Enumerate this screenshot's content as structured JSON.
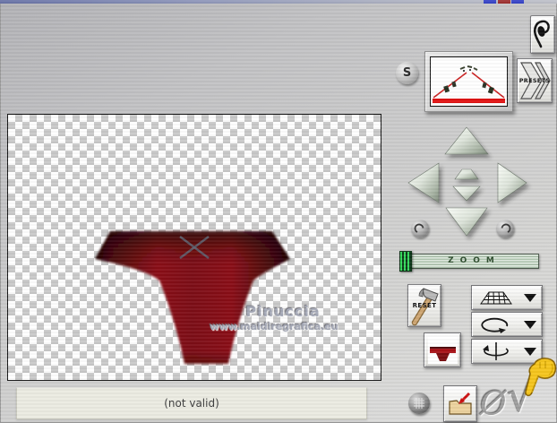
{
  "window": {
    "titlebar_marks": [
      "#3946c8",
      "#a03434",
      "#3946c8"
    ]
  },
  "preview": {
    "watermark_line1": "Pinuccia",
    "watermark_line2": "www.maidiregrafica.eu"
  },
  "status_bar": {
    "text": "(not valid)"
  },
  "panel": {
    "s_button_label": "S",
    "presets_label": "PRESETS",
    "zoom_label": "ZOOM",
    "reset_label": "RESET",
    "cancel_symbol": "Ø",
    "ok_symbol": "√"
  },
  "icons": {
    "ear": "ear-logo",
    "thumbnail": "perspective-scene-preview",
    "arrows": [
      "up",
      "left",
      "right",
      "down",
      "nudge-up",
      "nudge-down"
    ],
    "dropdowns": [
      "perspective-grid",
      "rotate-flat",
      "rotate-vertical-axis"
    ],
    "bottom": [
      "grid-ball",
      "import-folder",
      "cancel",
      "apply"
    ],
    "pointer": "yellow-hand-pointing-down"
  },
  "colors": {
    "shape_red_center": "#8a1016",
    "shape_red_edge": "#1d0203",
    "guide_red": "#dd2222",
    "slider_green": "#35d95c",
    "hand_yellow": "#f6c51d"
  }
}
